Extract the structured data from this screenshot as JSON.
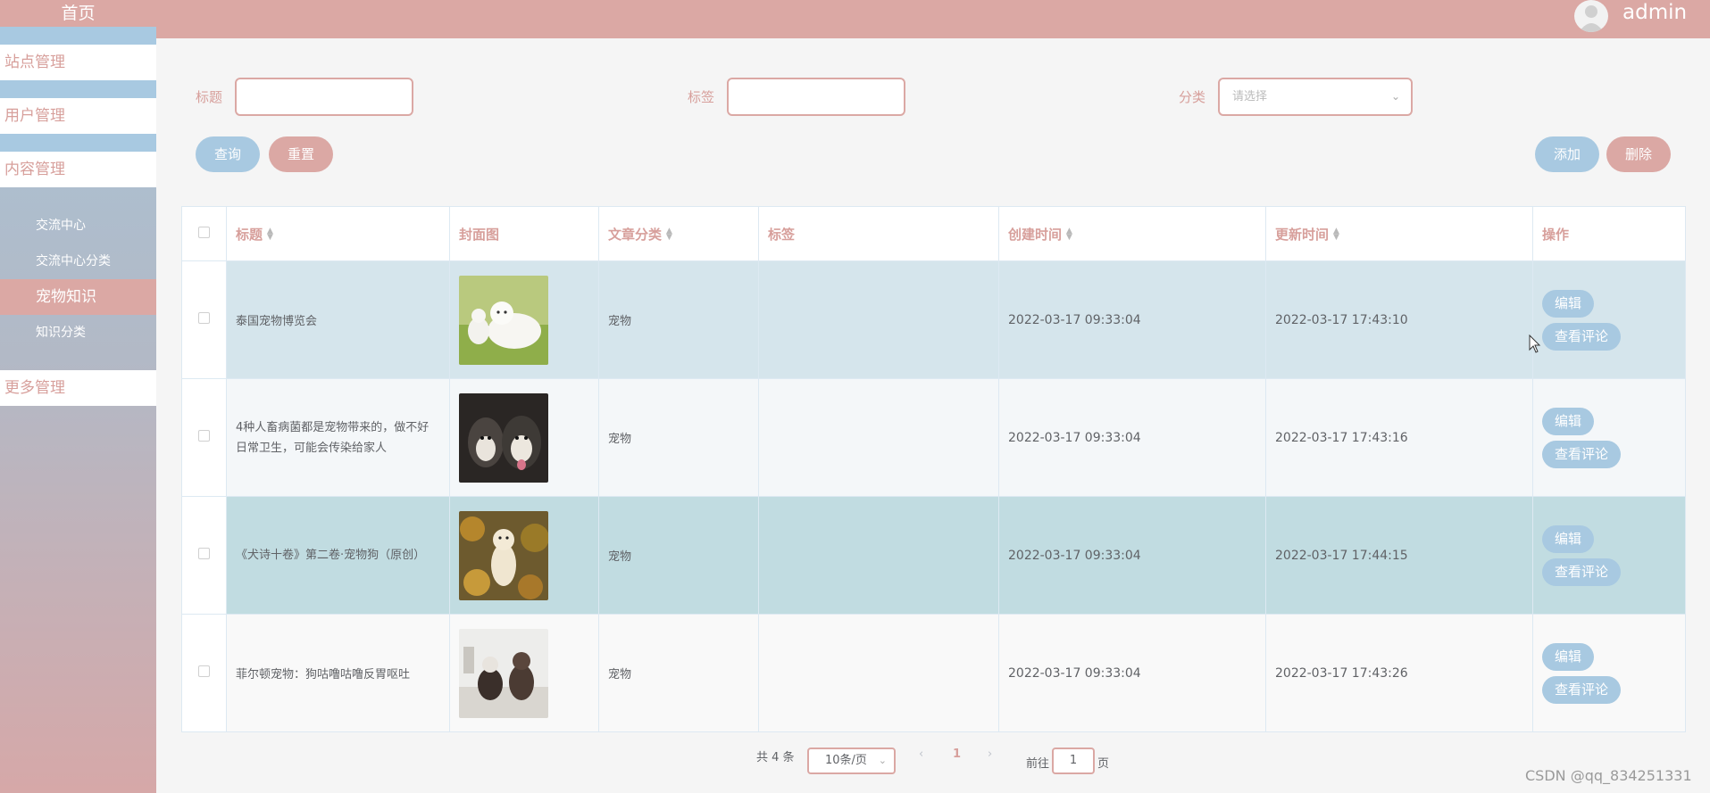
{
  "header": {
    "username": "admin"
  },
  "sidebar": {
    "home": "首页",
    "menus": {
      "site": "站点管理",
      "user": "用户管理",
      "content": "内容管理",
      "more": "更多管理"
    },
    "subs": [
      "交流中心",
      "交流中心分类",
      "宠物知识",
      "知识分类"
    ]
  },
  "search": {
    "title_label": "标题",
    "tag_label": "标签",
    "category_label": "分类",
    "category_placeholder": "请选择",
    "query_button": "查询",
    "reset_button": "重置",
    "add_button": "添加",
    "delete_button": "删除"
  },
  "table": {
    "headers": [
      "标题",
      "封面图",
      "文章分类",
      "标签",
      "创建时间",
      "更新时间",
      "操作"
    ],
    "edit_label": "编辑",
    "comment_label": "查看评论",
    "rows": [
      {
        "title": "泰国宠物博览会",
        "category": "宠物",
        "tag": "",
        "created": "2022-03-17 09:33:04",
        "updated": "2022-03-17 17:43:10",
        "image": "two-white-dogs-on-grass"
      },
      {
        "title": "4种人畜病菌都是宠物带来的，做不好日常卫生，可能会传染给家人",
        "category": "宠物",
        "tag": "",
        "created": "2022-03-17 09:33:04",
        "updated": "2022-03-17 17:43:16",
        "image": "two-husky-puppies"
      },
      {
        "title": "《犬诗十卷》第二卷·宠物狗（原创）",
        "category": "宠物",
        "tag": "",
        "created": "2022-03-17 09:33:04",
        "updated": "2022-03-17 17:44:15",
        "image": "puppy-among-autumn-leaves"
      },
      {
        "title": "菲尔顿宠物：狗咕噜咕噜反胃呕吐",
        "category": "宠物",
        "tag": "",
        "created": "2022-03-17 09:33:04",
        "updated": "2022-03-17 17:43:26",
        "image": "two-small-dogs-on-blanket"
      }
    ]
  },
  "pagination": {
    "total": "共 4 条",
    "page_size": "10条/页",
    "current_page": "1",
    "goto_label": "前往",
    "goto_value": "1",
    "page_suffix": "页"
  },
  "watermark": "CSDN @qq_834251331",
  "colors": {
    "brand_pink": "#dba8a4",
    "brand_blue": "#a8c9e1"
  }
}
